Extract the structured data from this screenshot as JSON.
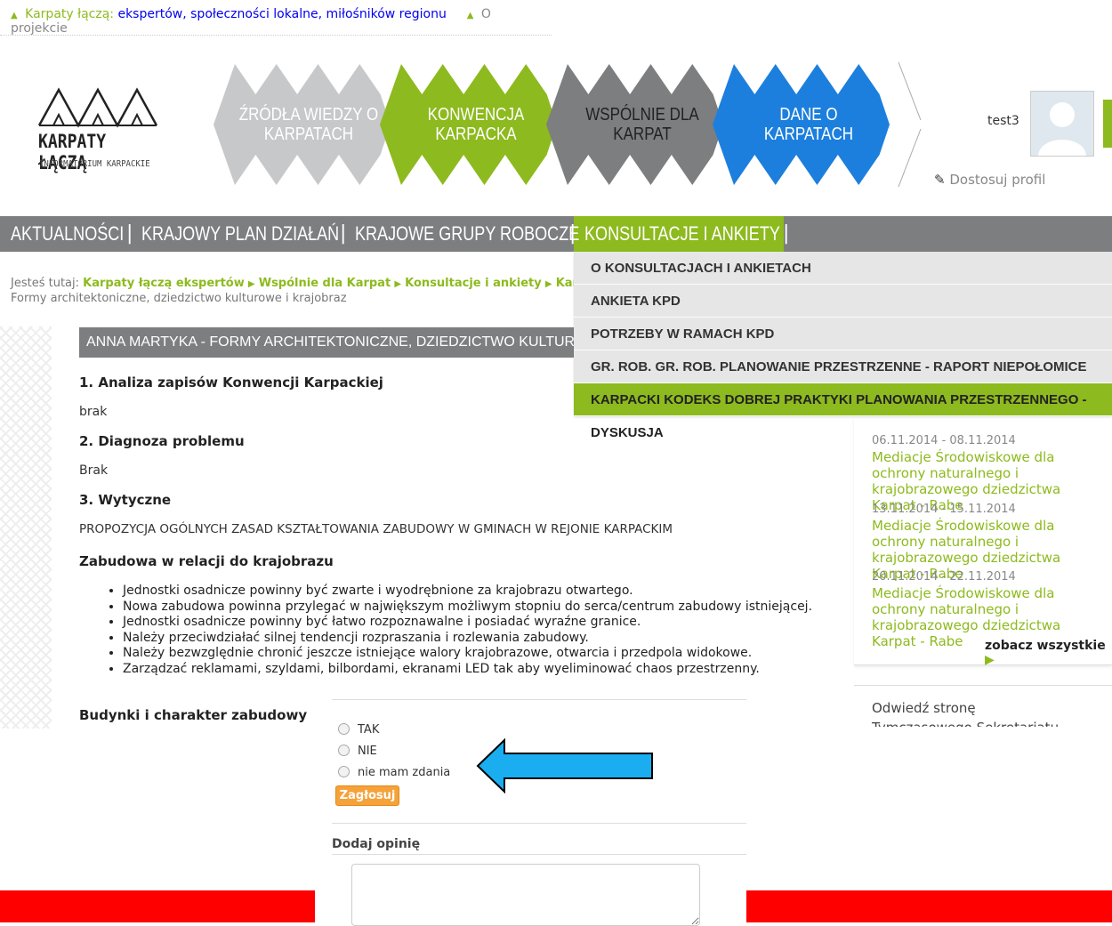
{
  "topbar": {
    "link1_prefix": "Karpaty łączą:",
    "link1_rest": " ekspertów, społeczności lokalne, miłośników regionu",
    "link2": "O projekcie"
  },
  "logo": {
    "name": "KARPATY ŁĄCZĄ",
    "subtitle": "INFORMATORIUM KARPACKIE"
  },
  "banner": [
    {
      "line1": "ŹRÓDŁA WIEDZY O",
      "line2": "KARPATACH",
      "color": "#c7c8c9"
    },
    {
      "line1": "KONWENCJA",
      "line2": "KARPACKA",
      "color": "#8dba1e"
    },
    {
      "line1": "WSPÓLNIE DLA",
      "line2": "KARPAT",
      "color": "#7d7e7f"
    },
    {
      "line1": "DANE O",
      "line2": "KARPATACH",
      "color": "#1c7fdd"
    }
  ],
  "user": {
    "name": "test3",
    "edit_profile": "Dostosuj profil"
  },
  "nav": {
    "items": [
      "AKTUALNOŚCI",
      "KRAJOWY PLAN DZIAŁAŃ",
      "KRAJOWE GRUPY ROBOCZE",
      "KONSULTACJE I ANKIETY"
    ],
    "sep": "|"
  },
  "dropdown": [
    "O KONSULTACJACH I ANKIETACH",
    "ANKIETA KPD",
    "POTRZEBY W RAMACH KPD",
    "GR. ROB. GR. ROB. PLANOWANIE PRZESTRZENNE - RAPORT NIEPOŁOMICE",
    "KARPACKI KODEKS DOBREJ PRAKTYKI PLANOWANIA PRZESTRZENNEGO - DYSKUSJA"
  ],
  "breadcrumb": {
    "prefix": "Jesteś tutaj:",
    "items": [
      "Karpaty łączą ekspertów",
      "Wspólnie dla Karpat",
      "Konsultacje i ankiety",
      "Kar"
    ],
    "line2": "Formy architektoniczne, dziedzictwo kulturowe i krajobraz"
  },
  "article": {
    "title": "ANNA MARTYKA - FORMY ARCHITEKTONICZNE, DZIEDZICTWO KULTUROWE I KRAJOBRAZ",
    "h1": "1. Analiza zapisów Konwencji Karpackiej",
    "p1": "brak",
    "h2": "2. Diagnoza problemu",
    "p2": "Brak",
    "h3": "3. Wytyczne",
    "p3": "PROPOZYCJA OGÓLNYCH ZASAD KSZTAŁTOWANIA ZABUDOWY W GMINACH W REJONIE KARPACKIM",
    "h4": "Zabudowa w relacji do krajobrazu",
    "bullets": [
      "Jednostki osadnicze powinny być zwarte i wyodrębnione za krajobrazu otwartego.",
      "Nowa zabudowa powinna przylegać w największym możliwym stopniu do serca/centrum zabudowy istniejącej.",
      "Jednostki osadnicze powinny być łatwo rozpoznawalne i posiadać wyraźne granice.",
      "Należy przeciwdziałać silnej tendencji rozpraszania i rozlewania zabudowy.",
      "Należy bezwzględnie chronić jeszcze istniejące walory krajobrazowe, otwarcia i przedpola widokowe.",
      "Zarządzać reklamami, szyldami, bilbordami, ekranami LED tak aby wyeliminować chaos przestrzenny."
    ],
    "h5": "Budynki i charakter zabudowy"
  },
  "events": {
    "items": [
      {
        "date": "06.11.2014 - 08.11.2014",
        "title": "Mediacje Środowiskowe dla ochrony naturalnego i krajobrazowego dziedzictwa Karpat - Rabe"
      },
      {
        "date": "13.11.2014 - 15.11.2014",
        "title": "Mediacje Środowiskowe dla ochrony naturalnego i krajobrazowego dziedzictwa Karpat - Rabe"
      },
      {
        "date": "20.11.2014 - 22.11.2014",
        "title": "Mediacje Środowiskowe dla ochrony naturalnego i krajobrazowego dziedzictwa Karpat - Rabe"
      }
    ],
    "see_all": "zobacz wszystkie"
  },
  "visit": {
    "line1": "Odwiedź stronę",
    "line2": "Tymczasowego Sekretariatu"
  },
  "poll": {
    "options": [
      "TAK",
      "NIE",
      "nie mam zdania"
    ],
    "vote_label": "Zagłosuj"
  },
  "comment": {
    "label": "Dodaj opinię",
    "value": ""
  },
  "colors": {
    "accent_green": "#8dba1e",
    "nav_gray": "#7d7e7f",
    "blue": "#1c7fdd",
    "arrow": "#1aaef0",
    "red_bar": "#ff0000"
  }
}
